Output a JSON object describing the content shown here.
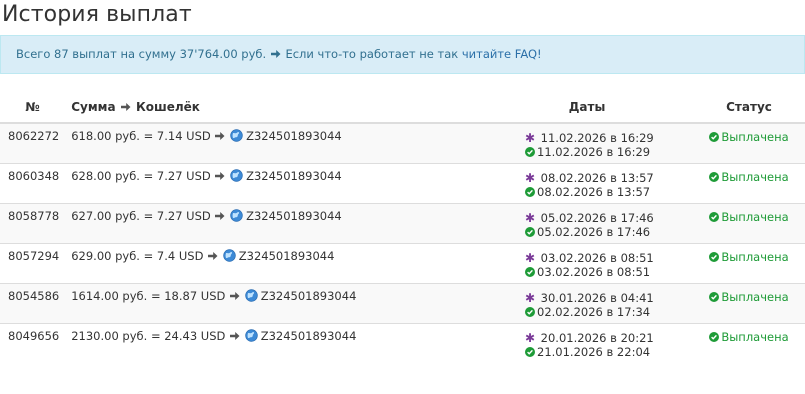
{
  "page": {
    "title": "История выплат"
  },
  "alert": {
    "summary": "Всего 87 выплат на сумму 37'764.00 руб.",
    "help_text": "Если что-то работает не так",
    "faq_link": "читайте FAQ!"
  },
  "table": {
    "headers": {
      "num": "№",
      "amount": "Сумма",
      "wallet": "Кошелёк",
      "dates": "Даты",
      "status": "Статус"
    },
    "rows": [
      {
        "id": "8062272",
        "amount": "618.00 руб. = 7.14 USD",
        "wallet": "Z324501893044",
        "requested": "11.02.2026 в 16:29",
        "paid": "11.02.2026 в 16:29",
        "status": "Выплачена"
      },
      {
        "id": "8060348",
        "amount": "628.00 руб. = 7.27 USD",
        "wallet": "Z324501893044",
        "requested": "08.02.2026 в 13:57",
        "paid": "08.02.2026 в 13:57",
        "status": "Выплачена"
      },
      {
        "id": "8058778",
        "amount": "627.00 руб. = 7.27 USD",
        "wallet": "Z324501893044",
        "requested": "05.02.2026 в 17:46",
        "paid": "05.02.2026 в 17:46",
        "status": "Выплачена"
      },
      {
        "id": "8057294",
        "amount": "629.00 руб. = 7.4 USD",
        "wallet": "Z324501893044",
        "requested": "03.02.2026 в 08:51",
        "paid": "03.02.2026 в 08:51",
        "status": "Выплачена"
      },
      {
        "id": "8054586",
        "amount": "1614.00 руб. = 18.87 USD",
        "wallet": "Z324501893044",
        "requested": "30.01.2026 в 04:41",
        "paid": "02.02.2026 в 17:34",
        "status": "Выплачена"
      },
      {
        "id": "8049656",
        "amount": "2130.00 руб. = 24.43 USD",
        "wallet": "Z324501893044",
        "requested": "20.01.2026 в 20:21",
        "paid": "21.01.2026 в 22:04",
        "status": "Выплачена"
      }
    ]
  },
  "icons": {
    "arrow": "arrow-right-icon",
    "wallet": "globe-icon",
    "requested": "asterisk-icon",
    "paid": "check-circle-icon"
  },
  "colors": {
    "alert_bg": "#d9edf7",
    "alert_text": "#31708f",
    "link": "#2a6fa8",
    "success": "#1e9b37",
    "requested_mark": "#7a3a98",
    "stripe": "#f9f9f9"
  }
}
